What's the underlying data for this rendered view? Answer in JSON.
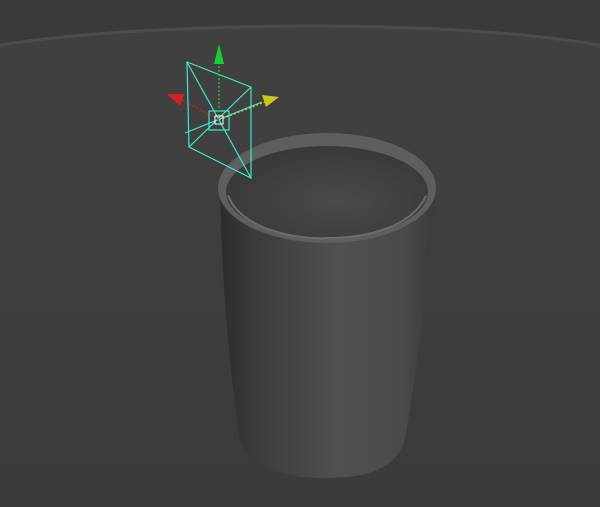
{
  "viewport": {
    "background_color": "#3a3a3a",
    "ground_color": "#4c4c4c",
    "horizon_band_color": "#555555"
  },
  "scene_objects": {
    "cup": {
      "icon": "cup-mesh",
      "body_color": "#4a4a4a",
      "rim_color": "#6a6a6a",
      "interior_color": "#3f3f3f"
    },
    "area_light": {
      "icon": "area-light-icon",
      "wire_color": "#3fe8c8"
    },
    "move_manipulator": {
      "icon": "move-tool-gizmo",
      "x_axis_color": "#d62020",
      "y_axis_color": "#1ecc3a",
      "z_axis_color": "#c8c81a",
      "pivot_color": "#ffffff"
    }
  }
}
